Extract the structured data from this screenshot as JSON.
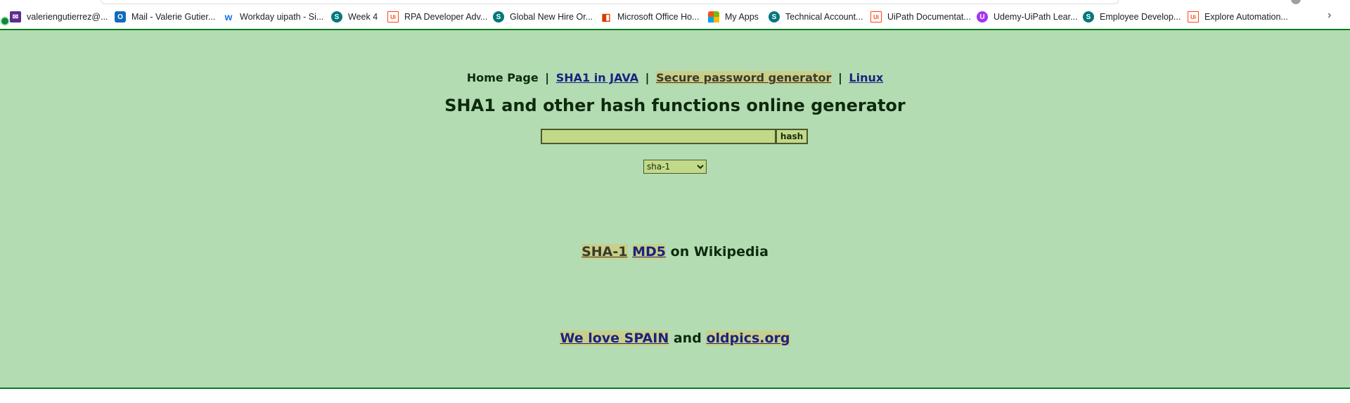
{
  "bookmarks": [
    {
      "label": "valeriengutierrez@...",
      "icon": "mail-icon",
      "glyph": "✉"
    },
    {
      "label": "Mail - Valerie Gutier...",
      "icon": "outlook-icon",
      "glyph": "O"
    },
    {
      "label": "Workday uipath - Si...",
      "icon": "workday-icon",
      "glyph": "w"
    },
    {
      "label": "Week 4",
      "icon": "sharepoint-icon",
      "glyph": "S"
    },
    {
      "label": "RPA Developer Adv...",
      "icon": "uipath-icon",
      "glyph": "Ui"
    },
    {
      "label": "Global New Hire Or...",
      "icon": "sharepoint-icon",
      "glyph": "S"
    },
    {
      "label": "Microsoft Office Ho...",
      "icon": "office-icon",
      "glyph": "◧"
    },
    {
      "label": "My Apps",
      "icon": "apps-icon",
      "glyph": ""
    },
    {
      "label": "Technical Account...",
      "icon": "sharepoint-icon",
      "glyph": "S"
    },
    {
      "label": "UiPath Documentat...",
      "icon": "uipath-icon",
      "glyph": "Ui"
    },
    {
      "label": "Udemy-UiPath Lear...",
      "icon": "udemy-icon",
      "glyph": "U"
    },
    {
      "label": "Employee Develop...",
      "icon": "sharepoint-icon",
      "glyph": "S"
    },
    {
      "label": "Explore Automation...",
      "icon": "uipath-icon",
      "glyph": "Ui"
    }
  ],
  "nav": {
    "home": "Home Page",
    "sep": "|",
    "sha1_java": "SHA1 in JAVA",
    "password_gen": "Secure password generator",
    "linux": "Linux"
  },
  "title": "SHA1 and other hash functions online generator",
  "form": {
    "input_value": "",
    "button_label": "hash",
    "algo_selected": "sha-1"
  },
  "wiki": {
    "sha1": "SHA-1",
    "md5": "MD5",
    "suffix": "on Wikipedia"
  },
  "footer": {
    "spain": "We love SPAIN",
    "and": "and",
    "oldpics": "oldpics.org"
  },
  "colors": {
    "page_bg": "#b3dcb3",
    "link": "#1a237e",
    "highlight": "#c8cf8a",
    "input_bg": "#c2d98a"
  }
}
